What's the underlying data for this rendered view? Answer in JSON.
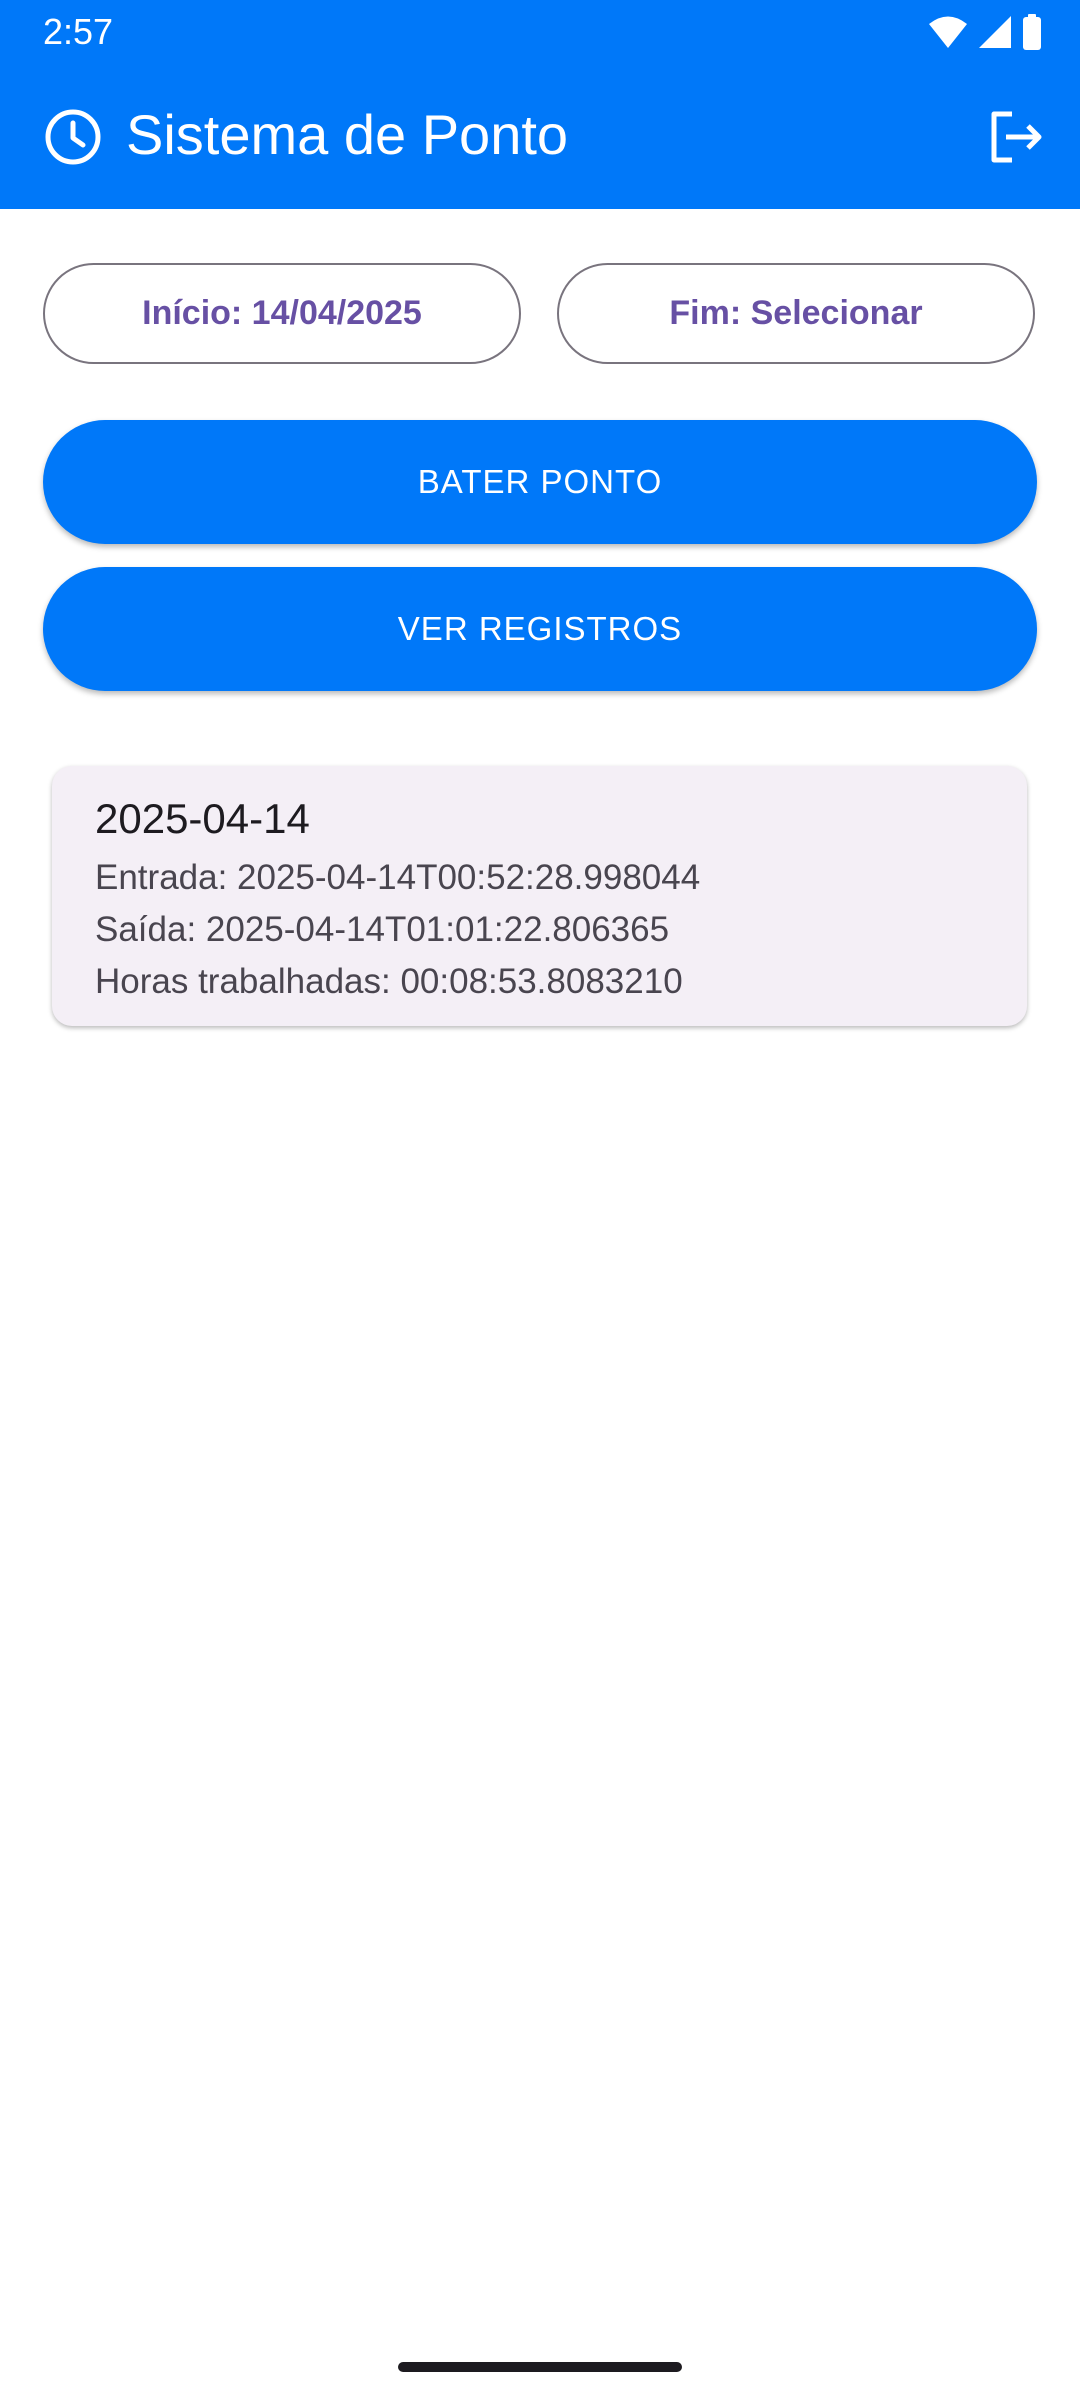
{
  "status_bar": {
    "time": "2:57",
    "icons": [
      "wifi-icon",
      "signal-icon",
      "battery-icon"
    ]
  },
  "app_bar": {
    "title": "Sistema de Ponto",
    "leading_icon": "clock-icon",
    "action_icon": "logout-icon",
    "color": "#0078F9"
  },
  "filters": {
    "start_label": "Início: 14/04/2025",
    "end_label": "Fim: Selecionar"
  },
  "actions": {
    "clock_in_label": "BATER PONTO",
    "view_records_label": "VER REGISTROS"
  },
  "records": [
    {
      "date": "2025-04-14",
      "entrada": "Entrada: 2025-04-14T00:52:28.998044",
      "saida": "Saída: 2025-04-14T01:01:22.806365",
      "horas": "Horas trabalhadas: 00:08:53.8083210"
    }
  ],
  "colors": {
    "primary": "#0078F9",
    "outline_text": "#6750A4",
    "card_background": "#F4EFF6"
  }
}
